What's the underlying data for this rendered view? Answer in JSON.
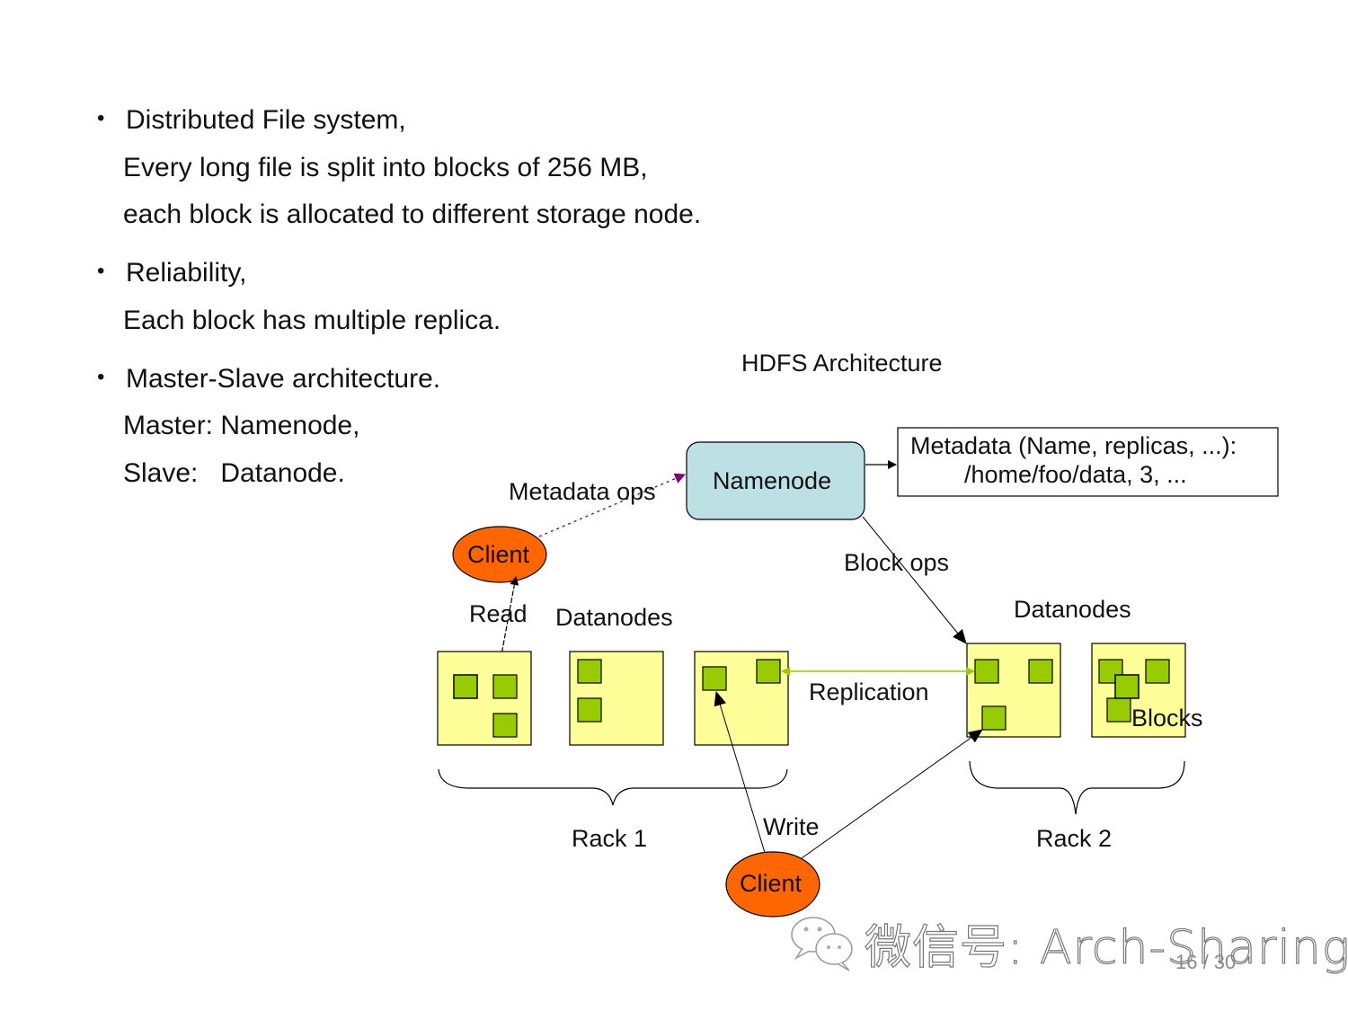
{
  "bullets": [
    {
      "title": "Distributed File system,",
      "lines": [
        "Every long file is split into blocks of 256 MB,",
        "each block is allocated to different storage node."
      ]
    },
    {
      "title": "Reliability,",
      "lines": [
        "Each block has multiple replica."
      ]
    },
    {
      "title": "Master-Slave architecture.",
      "lines": [
        "Master: Namenode,",
        "Slave:   Datanode."
      ]
    }
  ],
  "diagram": {
    "title": "HDFS Architecture",
    "namenode": "Namenode",
    "metadata_box": {
      "line1": "Metadata (Name, replicas, ...):",
      "line2": "/home/foo/data, 3, ..."
    },
    "metadata_ops": "Metadata ops",
    "block_ops": "Block ops",
    "client_top": "Client",
    "client_bottom": "Client",
    "read": "Read",
    "write": "Write",
    "replication": "Replication",
    "datanodes_left": "Datanodes",
    "datanodes_right": "Datanodes",
    "blocks": "Blocks",
    "rack1": "Rack 1",
    "rack2": "Rack 2",
    "colors": {
      "namenode_fill": "#bde0e4",
      "client_fill": "#ff6600",
      "datanode_fill": "#ffff99",
      "block_fill": "#99cc00",
      "replication_line": "#99cc00",
      "metadata_arrow": "#800080"
    }
  },
  "watermark": "微信号: Arch-Sharing",
  "page_number": "16 / 30"
}
